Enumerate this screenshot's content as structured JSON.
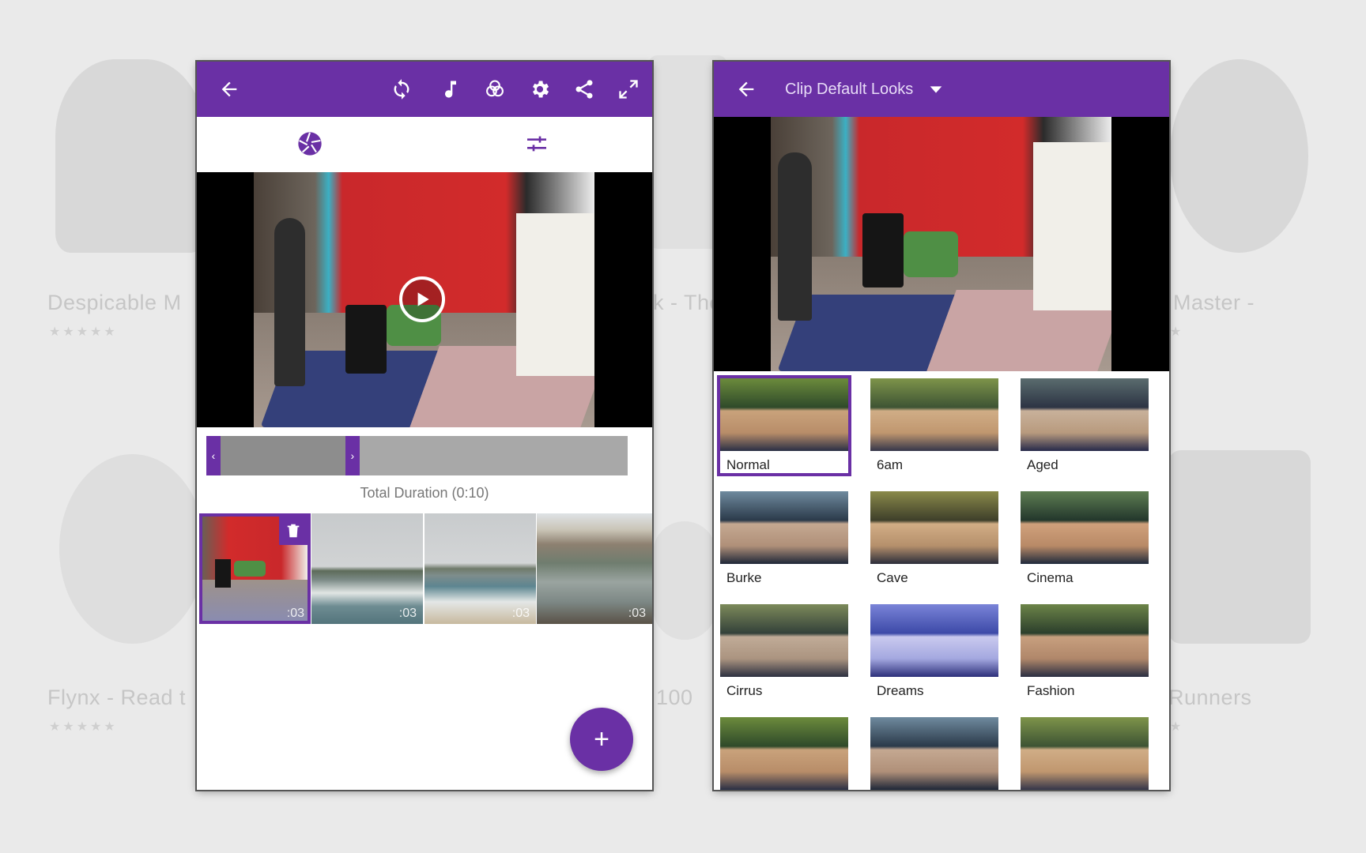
{
  "background": {
    "apps": [
      {
        "name": "Despicable M",
        "stars": "★★★★★"
      },
      {
        "name": "k - The",
        "stars": ""
      },
      {
        "name": "Master - ",
        "stars": "★"
      },
      {
        "name": "Flynx - Read t",
        "stars": "★★★★★"
      },
      {
        "name": "100",
        "stars": ""
      },
      {
        "name": "Runners",
        "stars": "★"
      }
    ]
  },
  "editor": {
    "toolbar": {
      "back_icon": "arrow-left-icon",
      "icons": [
        "refresh-icon",
        "music-note-icon",
        "color-circles-icon",
        "gear-icon",
        "share-icon",
        "expand-icon"
      ]
    },
    "tabs": [
      {
        "icon": "aperture-icon",
        "active": true
      },
      {
        "icon": "sliders-icon",
        "active": false
      }
    ],
    "timeline": {
      "trim_fraction": 0.33
    },
    "total_duration": "Total Duration (0:10)",
    "clips": [
      {
        "duration": ":03",
        "selected": true,
        "scene": "room"
      },
      {
        "duration": ":03",
        "selected": false,
        "scene": "coast"
      },
      {
        "duration": ":03",
        "selected": false,
        "scene": "beach"
      },
      {
        "duration": ":03",
        "selected": false,
        "scene": "cliff"
      }
    ],
    "fab_label": "+"
  },
  "looks_panel": {
    "title": "Clip Default Looks",
    "looks": [
      {
        "name": "Normal",
        "selected": true,
        "tint": "none"
      },
      {
        "name": "6am",
        "selected": false,
        "tint": "warm"
      },
      {
        "name": "Aged",
        "selected": false,
        "tint": "aged"
      },
      {
        "name": "Burke",
        "selected": false,
        "tint": "cool"
      },
      {
        "name": "Cave",
        "selected": false,
        "tint": "cave"
      },
      {
        "name": "Cinema",
        "selected": false,
        "tint": "cinema"
      },
      {
        "name": "Cirrus",
        "selected": false,
        "tint": "grey"
      },
      {
        "name": "Dreams",
        "selected": false,
        "tint": "dreams"
      },
      {
        "name": "Fashion",
        "selected": false,
        "tint": "fashion"
      },
      {
        "name": "",
        "selected": false,
        "tint": "none"
      },
      {
        "name": "",
        "selected": false,
        "tint": "cool"
      },
      {
        "name": "",
        "selected": false,
        "tint": "warm"
      }
    ]
  },
  "colors": {
    "accent": "#6a30a5",
    "appbar": "#6a30a5"
  }
}
